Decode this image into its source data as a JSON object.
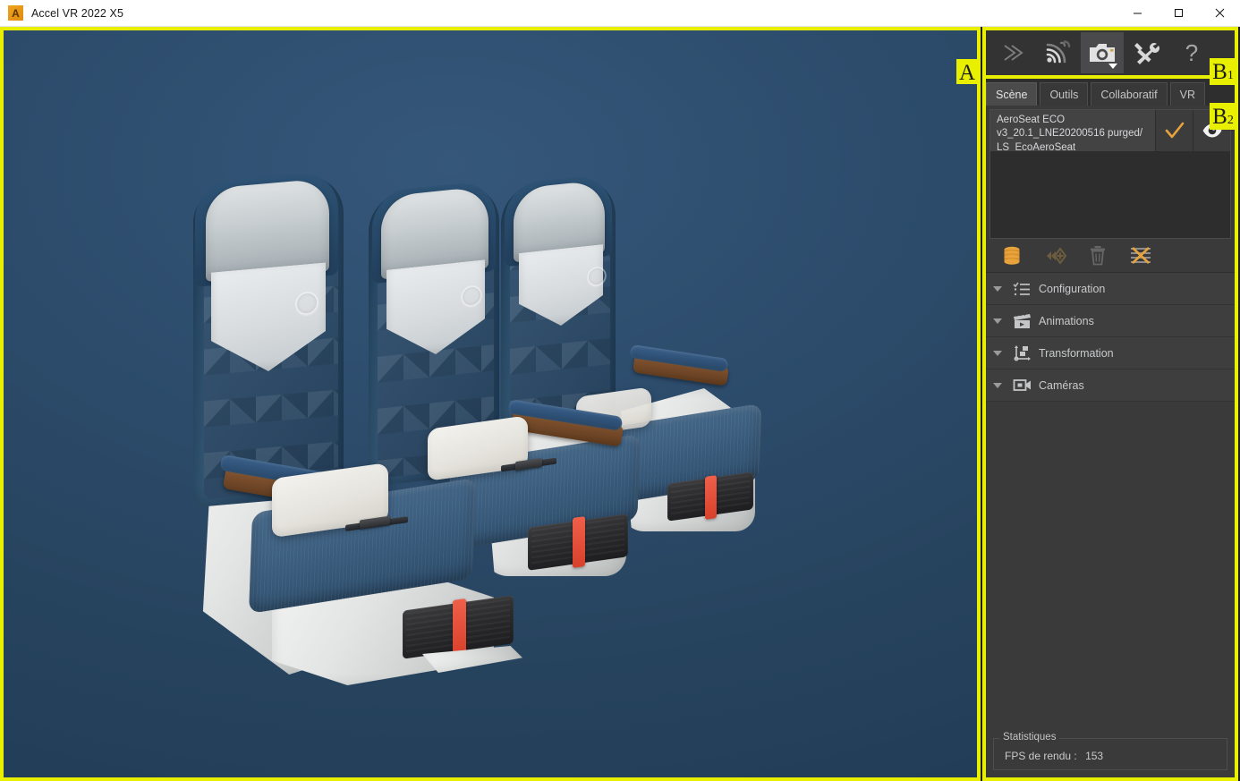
{
  "window": {
    "title": "Accel VR 2022 X5",
    "app_icon": "app-logo-icon",
    "minimize_label": "—",
    "maximize_label": "☐",
    "close_label": "✕"
  },
  "annotations": {
    "viewport_badge": "A",
    "toolbar_badge": "B",
    "toolbar_badge_sub": "1",
    "panel_badge": "B",
    "panel_badge_sub": "2",
    "badge_color": "#e8f000"
  },
  "viewport": {
    "name": "3d-viewport",
    "background_color": "#2b4a68",
    "content_description": "Row of three aircraft economy class seats rendered in 3D"
  },
  "toolbar": {
    "buttons": [
      {
        "name": "expand-chevron-icon",
        "label": "»",
        "tooltip": "Expand"
      },
      {
        "name": "streaming-icon",
        "label": "",
        "tooltip": "Streaming"
      },
      {
        "name": "camera-icon",
        "label": "",
        "tooltip": "Capture",
        "has_dropdown": true,
        "active": true
      },
      {
        "name": "tools-icon",
        "label": "",
        "tooltip": "Outils"
      },
      {
        "name": "help-icon",
        "label": "?",
        "tooltip": "Aide"
      }
    ]
  },
  "panel": {
    "tabs": [
      {
        "label": "Scène",
        "active": true
      },
      {
        "label": "Outils",
        "active": false
      },
      {
        "label": "Collaboratif",
        "active": false
      },
      {
        "label": "VR",
        "active": false
      }
    ],
    "scene_items": [
      {
        "label": "AeroSeat ECO\nv3_20.1_LNE20200516 purged/\nLS_EcoAeroSeat",
        "checked": true,
        "visible": true,
        "check_icon": "check-icon",
        "eye_icon": "eye-icon"
      }
    ],
    "list_actions": [
      {
        "name": "database-stack-icon",
        "enabled": true,
        "color": "#e8a33d"
      },
      {
        "name": "add-node-icon",
        "enabled": false,
        "color": "#6d5c3d"
      },
      {
        "name": "delete-trash-icon",
        "enabled": false,
        "color": "#6a6a6a"
      },
      {
        "name": "clear-list-icon",
        "enabled": true,
        "color": "#e8a33d"
      }
    ],
    "accordion": [
      {
        "label": "Configuration",
        "icon": "checklist-icon",
        "expanded": false
      },
      {
        "label": "Animations",
        "icon": "clapperboard-icon",
        "expanded": false
      },
      {
        "label": "Transformation",
        "icon": "transform-node-icon",
        "expanded": false
      },
      {
        "label": "Caméras",
        "icon": "video-camera-icon",
        "expanded": false
      }
    ],
    "statistics": {
      "legend": "Statistiques",
      "fps_label": "FPS de rendu :",
      "fps_value": "153"
    }
  }
}
